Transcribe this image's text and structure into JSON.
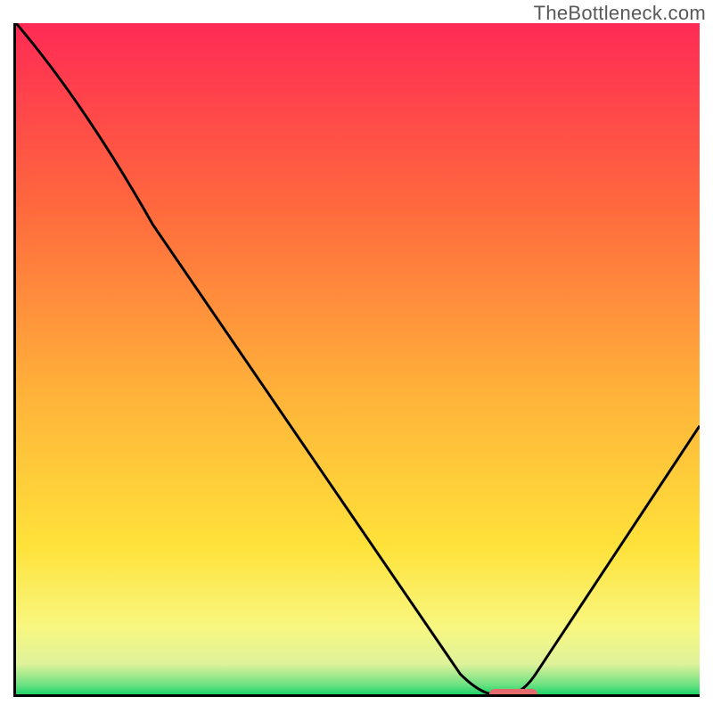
{
  "watermark": "TheBottleneck.com",
  "chart_data": {
    "type": "line",
    "title": "",
    "xlabel": "",
    "ylabel": "",
    "xlim": [
      0,
      100
    ],
    "ylim": [
      0,
      100
    ],
    "x": [
      0,
      20,
      68,
      74,
      100
    ],
    "values": [
      100,
      70,
      0,
      0,
      40
    ],
    "gradient_stops": [
      {
        "pos": 0.0,
        "color": "#ff2a55"
      },
      {
        "pos": 0.28,
        "color": "#ff6a3d"
      },
      {
        "pos": 0.55,
        "color": "#ffb23a"
      },
      {
        "pos": 0.78,
        "color": "#ffe23a"
      },
      {
        "pos": 0.9,
        "color": "#f8f780"
      },
      {
        "pos": 0.955,
        "color": "#dff29a"
      },
      {
        "pos": 0.985,
        "color": "#6fe283"
      },
      {
        "pos": 1.0,
        "color": "#1fd36a"
      }
    ],
    "marker": {
      "x_start": 69,
      "x_end": 76,
      "y": 0,
      "color": "#e46a6e"
    }
  }
}
